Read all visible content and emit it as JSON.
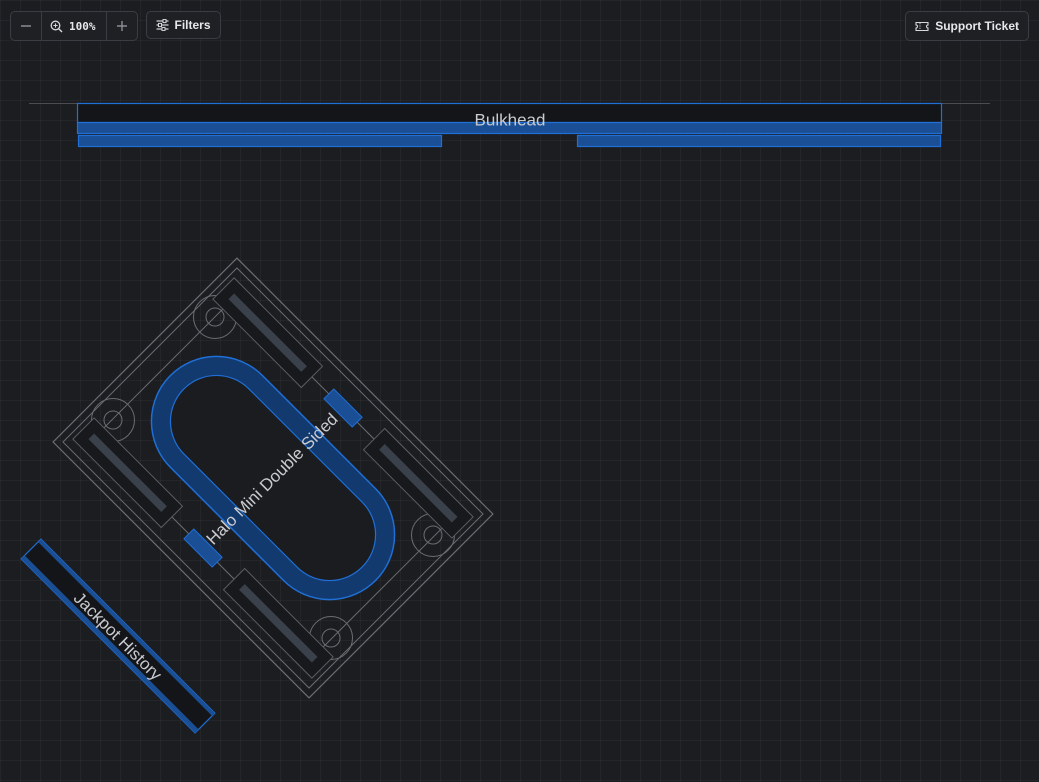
{
  "toolbar": {
    "zoom_minus_icon": "minus-icon",
    "zoom_in_icon": "zoom-in-icon",
    "zoom_level": "100%",
    "zoom_plus_icon": "plus-icon",
    "filters_label": "Filters",
    "filters_icon": "sliders-icon",
    "support_label": "Support Ticket",
    "support_icon": "ticket-icon"
  },
  "floor": {
    "bulkhead_label": "Bulkhead",
    "table_label": "Halo Mini Double Sided",
    "jackpot_label": "Jackpot History"
  },
  "colors": {
    "background": "#1c1d21",
    "accent_blue": "#1f6fd6",
    "accent_fill": "#123a6e",
    "outline_gray": "#6b6d73",
    "text": "#e6e7ea"
  }
}
